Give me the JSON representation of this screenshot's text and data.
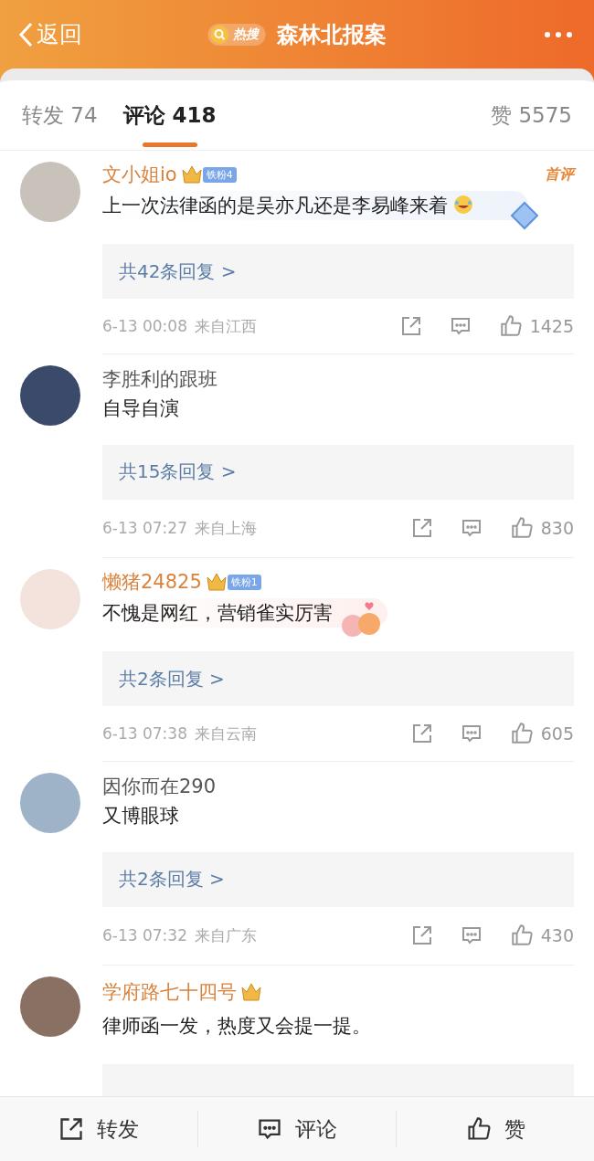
{
  "header": {
    "back": "返回",
    "hot_tag": "热搜",
    "title": "森林北报案"
  },
  "tabs": [
    {
      "label": "转发 74",
      "selected": false
    },
    {
      "label": "评论 418",
      "selected": true
    }
  ],
  "likes_tab": "赞 5575",
  "comments": [
    {
      "name": "文小姐io",
      "vip": true,
      "badge": "铁粉4",
      "first": "首评",
      "content": "上一次法律函的是吴亦凡还是李易峰来着",
      "emoji": true,
      "kind": "diamond",
      "replies": "共42条回复 >",
      "time": "6-13 00:08",
      "location": "来自江西",
      "likes": "1425"
    },
    {
      "name": "李胜利的跟班",
      "vip": false,
      "content": "自导自演",
      "emoji": false,
      "kind": "plain",
      "replies": "共15条回复 >",
      "time": "6-13 07:27",
      "location": "来自上海",
      "likes": "830"
    },
    {
      "name": "懒猪24825",
      "vip": true,
      "badge": "铁粉1",
      "content": "不愧是网红，营销雀实厉害",
      "emoji": false,
      "kind": "hearts",
      "replies": "共2条回复 >",
      "time": "6-13 07:38",
      "location": "来自云南",
      "likes": "605"
    },
    {
      "name": "因你而在290",
      "vip": false,
      "content": "又博眼球",
      "emoji": false,
      "kind": "plain",
      "replies": "共2条回复 >",
      "time": "6-13 07:32",
      "location": "来自广东",
      "likes": "430"
    },
    {
      "name": "学府路七十四号",
      "vip": true,
      "content": "律师函一发，热度又会提一提。",
      "emoji": false,
      "kind": "plain"
    }
  ],
  "bottom_bar": [
    {
      "kind": "repost",
      "label": "转发"
    },
    {
      "kind": "comment",
      "label": "评论"
    },
    {
      "kind": "like",
      "label": "赞"
    }
  ]
}
